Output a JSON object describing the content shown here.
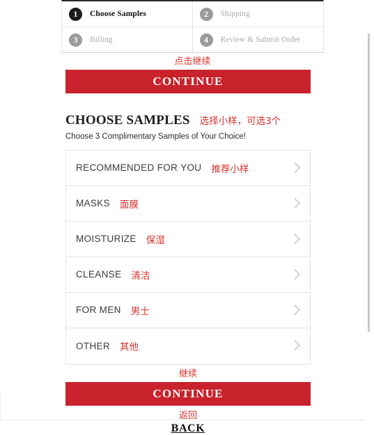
{
  "checkout_steps": [
    {
      "number": "1",
      "label": "Choose Samples",
      "active": true
    },
    {
      "number": "2",
      "label": "Shipping",
      "active": false
    },
    {
      "number": "3",
      "label": "Billing",
      "active": false
    },
    {
      "number": "4",
      "label": "Review & Submit Order",
      "active": false
    }
  ],
  "top": {
    "annotation_cn": "点击继续",
    "continue_label": "CONTINUE"
  },
  "samples_section": {
    "title": "CHOOSE SAMPLES",
    "title_annotation_cn": "选择小样，可选3个",
    "subtitle": "Choose 3 Complimentary Samples of Your Choice!",
    "items": [
      {
        "name": "RECOMMENDED FOR YOU",
        "annotation_cn": "推荐小样",
        "chevron": "chevron-right-icon"
      },
      {
        "name": "MASKS",
        "annotation_cn": "面膜",
        "chevron": "chevron-right-icon"
      },
      {
        "name": "MOISTURIZE",
        "annotation_cn": "保湿",
        "chevron": "chevron-right-icon"
      },
      {
        "name": "CLEANSE",
        "annotation_cn": "清洁",
        "chevron": "chevron-right-icon"
      },
      {
        "name": "FOR MEN",
        "annotation_cn": "男士",
        "chevron": "chevron-right-icon"
      },
      {
        "name": "OTHER",
        "annotation_cn": "其他",
        "chevron": "chevron-right-icon"
      }
    ]
  },
  "bottom": {
    "annotation_cn": "继续",
    "continue_label": "CONTINUE",
    "back_annotation_cn": "返回",
    "back_label": "BACK"
  },
  "colors": {
    "accent_red": "#C8232C",
    "annotation_red": "#D6332E",
    "active_step": "#1B1B1B",
    "inactive_step": "#9B9B9B"
  }
}
